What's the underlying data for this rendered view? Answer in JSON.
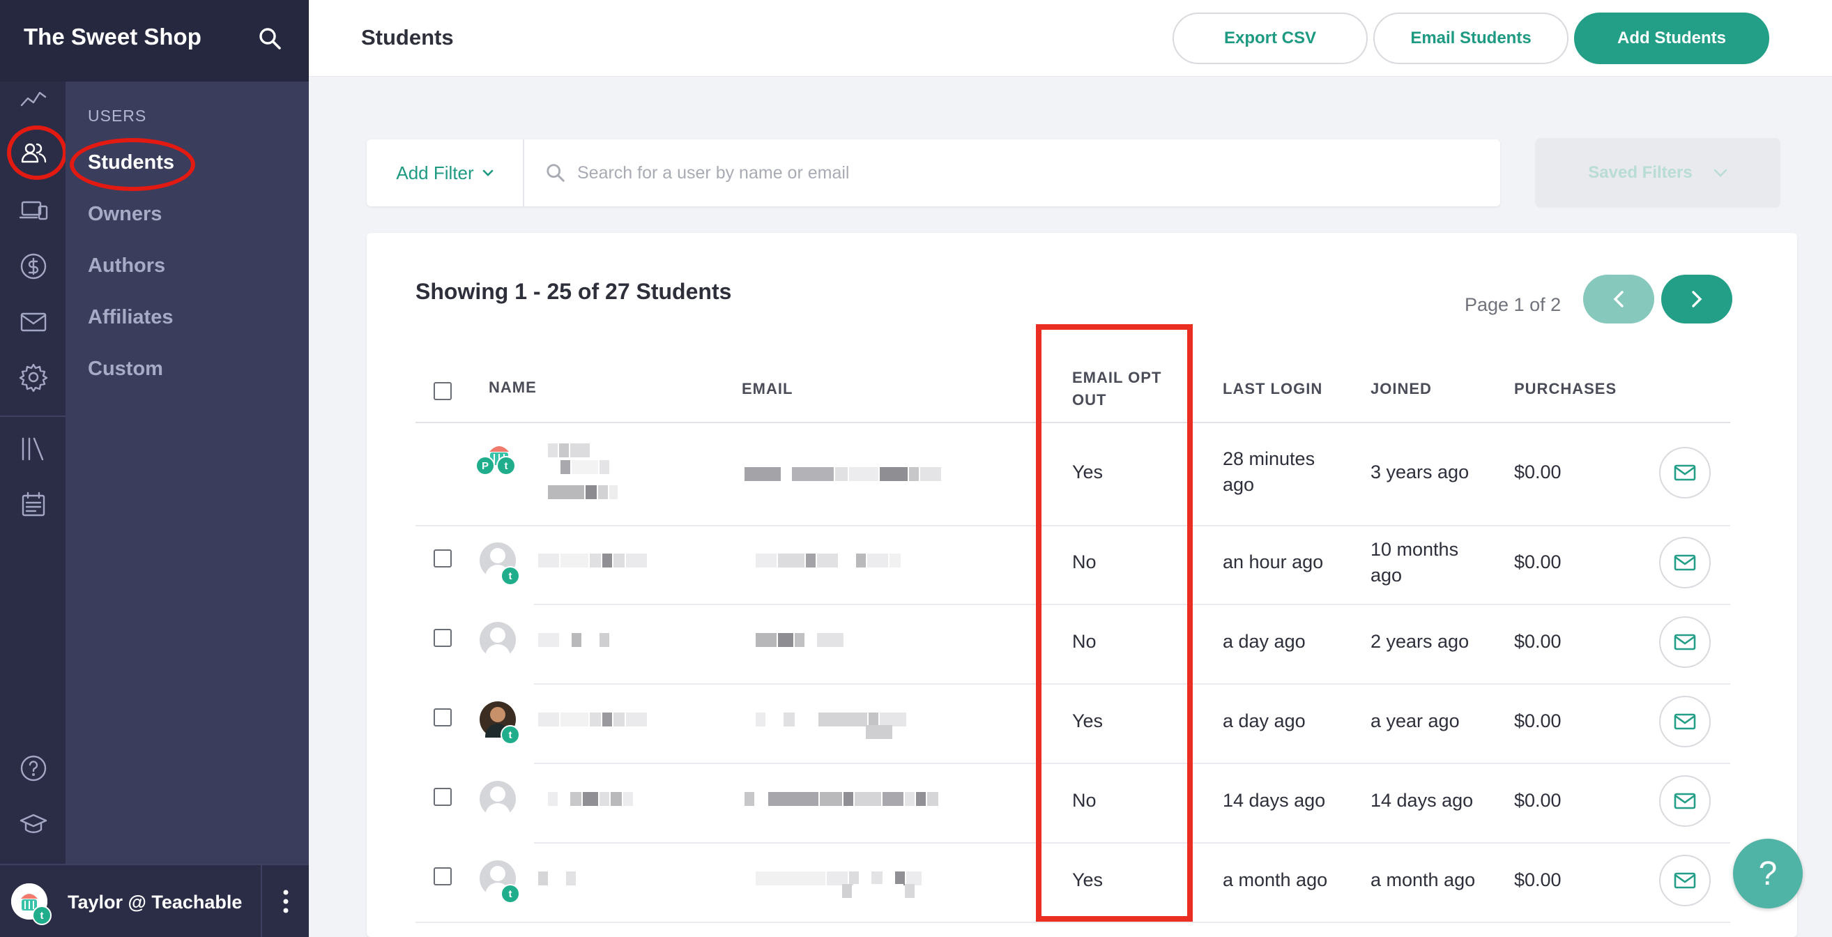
{
  "app": {
    "brand": "The Sweet Shop"
  },
  "header": {
    "title": "Students",
    "buttons": {
      "export": "Export CSV",
      "email": "Email Students",
      "add": "Add Students"
    }
  },
  "sidebar": {
    "heading": "USERS",
    "items": [
      {
        "label": "Students",
        "active": true
      },
      {
        "label": "Owners"
      },
      {
        "label": "Authors"
      },
      {
        "label": "Affiliates"
      },
      {
        "label": "Custom"
      }
    ],
    "rail_icons": [
      "analytics-icon",
      "users-icon",
      "devices-icon",
      "dollar-icon",
      "mail-icon",
      "gear-icon",
      "library-icon",
      "calendar-icon",
      "help-icon",
      "graduation-cap-icon"
    ]
  },
  "user": {
    "name": "Taylor @ Teachable"
  },
  "filters": {
    "add_filter": "Add Filter",
    "search_placeholder": "Search for a user by name or email",
    "saved_filters": "Saved Filters"
  },
  "table": {
    "showing": "Showing 1 - 25 of 27 Students",
    "page_info": "Page 1 of 2",
    "columns": {
      "name": "NAME",
      "email": "EMAIL",
      "opt_out_line1": "EMAIL OPT",
      "opt_out_line2": "OUT",
      "last_login": "LAST LOGIN",
      "joined": "JOINED",
      "purchases": "PURCHASES"
    },
    "rows": [
      {
        "opt_out": "Yes",
        "last_login_1": "28 minutes",
        "last_login_2": "ago",
        "joined_1": "3 years ago",
        "joined_2": "",
        "purchases": "$0.00",
        "avatar": "owner",
        "badge": "P"
      },
      {
        "opt_out": "No",
        "last_login_1": "an hour ago",
        "last_login_2": "",
        "joined_1": "10 months",
        "joined_2": "ago",
        "purchases": "$0.00",
        "avatar": "default",
        "badge": "t"
      },
      {
        "opt_out": "No",
        "last_login_1": "a day ago",
        "last_login_2": "",
        "joined_1": "2 years ago",
        "joined_2": "",
        "purchases": "$0.00",
        "avatar": "default"
      },
      {
        "opt_out": "Yes",
        "last_login_1": "a day ago",
        "last_login_2": "",
        "joined_1": "a year ago",
        "joined_2": "",
        "purchases": "$0.00",
        "avatar": "photo",
        "badge": "t"
      },
      {
        "opt_out": "No",
        "last_login_1": "14 days ago",
        "last_login_2": "",
        "joined_1": "14 days ago",
        "joined_2": "",
        "purchases": "$0.00",
        "avatar": "default"
      },
      {
        "opt_out": "Yes",
        "last_login_1": "a month ago",
        "last_login_2": "",
        "joined_1": "a month ago",
        "joined_2": "",
        "purchases": "$0.00",
        "avatar": "default",
        "badge": "t"
      }
    ]
  },
  "help": {
    "label": "?"
  },
  "colors": {
    "accent": "#239e87",
    "sidebar": "#2b2d46",
    "subnav": "#3a3d5c",
    "highlight": "#ea2f22"
  }
}
